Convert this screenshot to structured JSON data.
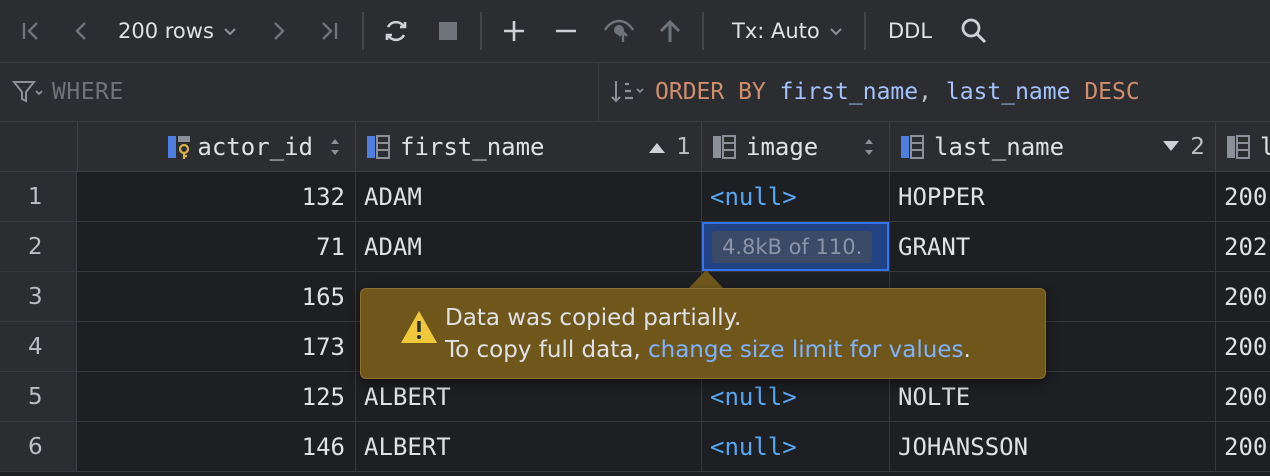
{
  "toolbar": {
    "page_size": "200 rows",
    "tx_mode": "Tx: Auto",
    "ddl_label": "DDL"
  },
  "filter": {
    "where_placeholder": "WHERE",
    "order_by_keyword": "ORDER BY",
    "order_col1": "first_name",
    "order_sep": ",",
    "order_col2": "last_name",
    "order_dir": "DESC"
  },
  "columns": [
    {
      "name": "actor_id",
      "sort": ""
    },
    {
      "name": "first_name",
      "sort": "1",
      "sort_dir": "asc"
    },
    {
      "name": "image",
      "sort": ""
    },
    {
      "name": "last_name",
      "sort": "2",
      "sort_dir": "desc"
    },
    {
      "name": "l"
    }
  ],
  "rows": [
    {
      "num": "1",
      "actor_id": "132",
      "first_name": "ADAM",
      "image": "<null>",
      "last_name": "HOPPER",
      "last_update": "200"
    },
    {
      "num": "2",
      "actor_id": "71",
      "first_name": "ADAM",
      "image": "4.8kB of 110.",
      "last_name": "GRANT",
      "last_update": "202"
    },
    {
      "num": "3",
      "actor_id": "165",
      "first_name": "",
      "image": "",
      "last_name": "",
      "last_update": "200"
    },
    {
      "num": "4",
      "actor_id": "173",
      "first_name": "",
      "image": "",
      "last_name": "",
      "last_update": "200"
    },
    {
      "num": "5",
      "actor_id": "125",
      "first_name": "ALBERT",
      "image": "<null>",
      "last_name": "NOLTE",
      "last_update": "200"
    },
    {
      "num": "6",
      "actor_id": "146",
      "first_name": "ALBERT",
      "image": "<null>",
      "last_name": "JOHANSSON",
      "last_update": "200"
    }
  ],
  "tooltip": {
    "line1": "Data was copied partially.",
    "line2_prefix": "To copy full data, ",
    "link": "change size limit for values",
    "line2_suffix": "."
  },
  "colors": {
    "accent": "#3574f0",
    "warning_bg": "#6f571c",
    "null_text": "#56a8f5",
    "keyword": "#cf8e6d",
    "identifier": "#a5c2ff"
  }
}
